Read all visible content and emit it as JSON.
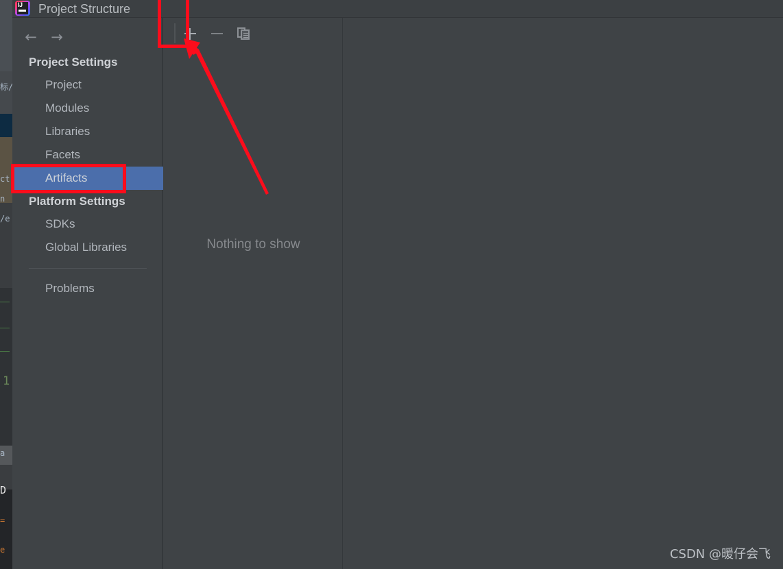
{
  "window": {
    "title": "Project Structure",
    "app_icon": "intellij-idea-icon",
    "app_icon_text": "IJ"
  },
  "navigation": {
    "back_label": "←",
    "forward_label": "→"
  },
  "sidebar": {
    "groups": [
      {
        "title": "Project Settings",
        "items": [
          {
            "label": "Project",
            "selected": false
          },
          {
            "label": "Modules",
            "selected": false
          },
          {
            "label": "Libraries",
            "selected": false
          },
          {
            "label": "Facets",
            "selected": false
          },
          {
            "label": "Artifacts",
            "selected": true
          }
        ]
      },
      {
        "title": "Platform Settings",
        "items": [
          {
            "label": "SDKs",
            "selected": false
          },
          {
            "label": "Global Libraries",
            "selected": false
          }
        ]
      }
    ],
    "extra_items": [
      {
        "label": "Problems",
        "selected": false
      }
    ]
  },
  "toolbar": {
    "add_label": "+",
    "add_icon": "plus-icon",
    "remove_label": "−",
    "remove_icon": "minus-icon",
    "copy_icon": "copy-icon"
  },
  "detail_pane": {
    "empty_message": "Nothing to show"
  },
  "watermark": {
    "text": "CSDN @暖仔会飞"
  },
  "annotations": {
    "highlight_color": "#fc0d1c",
    "add_button_box_label": "add-artifact-highlight",
    "artifacts_box_label": "artifacts-item-highlight",
    "arrow_label": "pointer-arrow-to-add-button"
  },
  "colors": {
    "selection_blue": "#4b6eab",
    "panel_background": "#3f4346",
    "titlebar_background": "#3c4043",
    "text_primary": "#b2b7bd",
    "text_muted": "#86898d"
  },
  "background_ide": {
    "fragments": [
      {
        "text": "标/",
        "color": "#a9b7c6"
      },
      {
        "text": "ct",
        "color": "#a9b7c6"
      },
      {
        "text": "n",
        "color": "#a9b7c6"
      },
      {
        "text": "/e",
        "color": "#a9b7c6"
      },
      {
        "text": "1",
        "color": "#6a8759"
      },
      {
        "text": "a",
        "color": "#a9b7c6"
      },
      {
        "text": "D",
        "color": "#e8e8e8"
      },
      {
        "text": "=",
        "color": "#cc7832"
      },
      {
        "text": "e",
        "color": "#cc7832"
      }
    ]
  }
}
